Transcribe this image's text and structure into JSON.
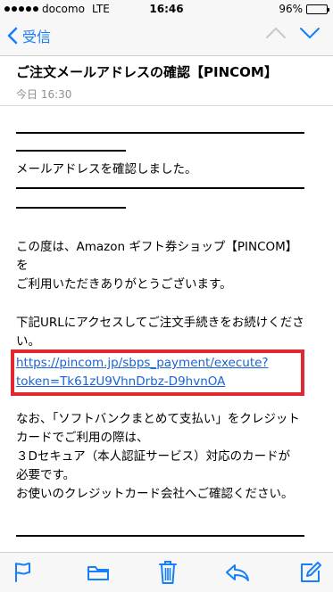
{
  "status_bar": {
    "carrier": "docomo",
    "network": "LTE",
    "time": "16:46",
    "battery": "96%",
    "battery_level": 0.96,
    "signal_bars_filled": 5
  },
  "nav": {
    "back_label": "受信"
  },
  "message": {
    "subject": "ご注文メールアドレスの確認【PINCOM】",
    "date": "今日 16:30",
    "body": {
      "line_confirm": "メールアドレスを確認しました。",
      "para1": [
        "この度は、Amazon ギフト券ショップ【PINCOM】",
        "を",
        "ご利用いただきありがとうございます。"
      ],
      "para2": [
        "下記URLにアクセスしてご注文手続きをお続けくださ",
        "い。"
      ],
      "link": [
        "https://pincom.jp/sbps_payment/execute?",
        "token=Tk61zU9VhnDrbz-D9hvnOA"
      ],
      "para3": [
        "なお、「ソフトバンクまとめて支払い」をクレジット",
        "カードでご利用の際は、",
        "３Dセキュア（本人認証サービス）対応のカードが",
        "必要です。",
        "お使いのクレジットカード会社へご確認ください。"
      ]
    }
  },
  "toolbar": {
    "icons": [
      "flag-icon",
      "folder-icon",
      "trash-icon",
      "reply-icon",
      "compose-icon"
    ]
  },
  "colors": {
    "accent": "#157efb",
    "link": "#1a63d6",
    "highlight": "#e2282f",
    "trash": "#157efb"
  }
}
